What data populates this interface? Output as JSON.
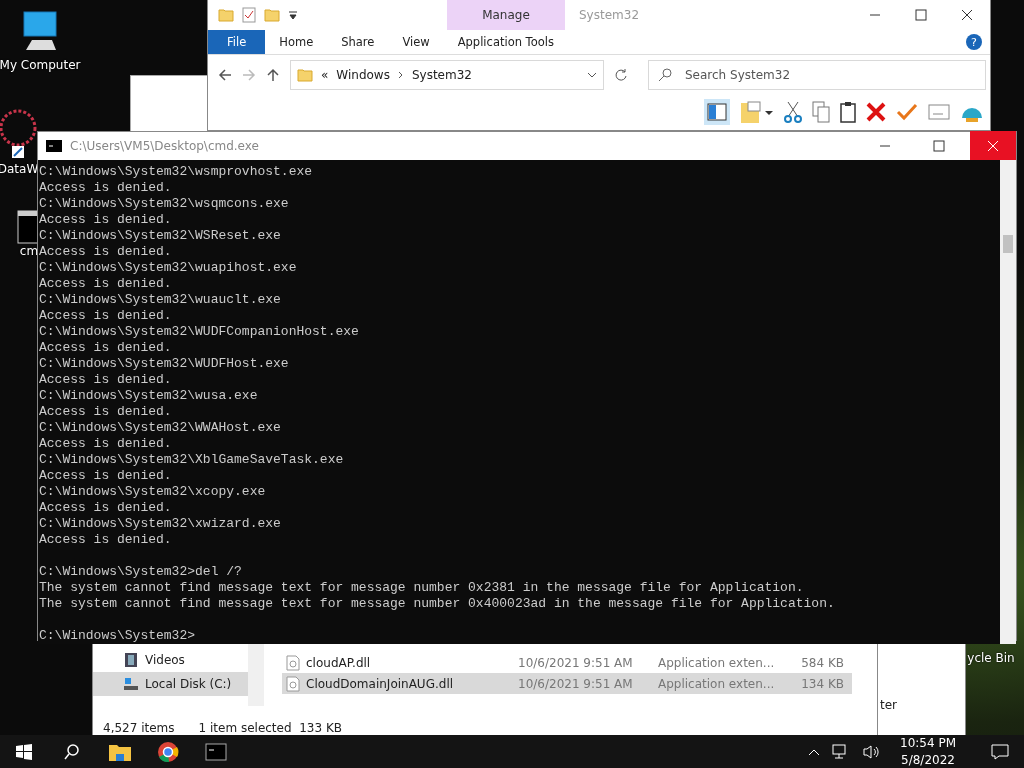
{
  "desktop_icons": [
    {
      "kind": "computer",
      "label": "My Computer"
    },
    {
      "kind": "app",
      "label": "DataW"
    },
    {
      "kind": "console",
      "label": "cm"
    },
    {
      "kind": "bin",
      "label": "ycle Bin"
    }
  ],
  "explorer": {
    "context_tab": "Manage",
    "title": "System32",
    "tabs": [
      {
        "label": "File",
        "selected": true
      },
      {
        "label": "Home",
        "selected": false
      },
      {
        "label": "Share",
        "selected": false
      },
      {
        "label": "View",
        "selected": false
      },
      {
        "label": "Application Tools",
        "selected": false
      }
    ],
    "address_prefix": "«",
    "address": [
      "Windows",
      "System32"
    ],
    "search": {
      "placeholder": "Search System32"
    },
    "help": "?"
  },
  "cmd": {
    "title": "C:\\Users\\VM5\\Desktop\\cmd.exe",
    "blocks": [
      [
        "C:\\Windows\\System32\\wsmprovhost.exe",
        "Access is denied.",
        "C:\\Windows\\System32\\wsqmcons.exe",
        "Access is denied.",
        "C:\\Windows\\System32\\WSReset.exe",
        "Access is denied.",
        "C:\\Windows\\System32\\wuapihost.exe",
        "Access is denied.",
        "C:\\Windows\\System32\\wuauclt.exe",
        "Access is denied.",
        "C:\\Windows\\System32\\WUDFCompanionHost.exe",
        "Access is denied.",
        "C:\\Windows\\System32\\WUDFHost.exe",
        "Access is denied.",
        "C:\\Windows\\System32\\wusa.exe",
        "Access is denied.",
        "C:\\Windows\\System32\\WWAHost.exe",
        "Access is denied.",
        "C:\\Windows\\System32\\XblGameSaveTask.exe",
        "Access is denied.",
        "C:\\Windows\\System32\\xcopy.exe",
        "Access is denied.",
        "C:\\Windows\\System32\\xwizard.exe",
        "Access is denied."
      ],
      [
        "C:\\Windows\\System32>del /?",
        "The system cannot find message text for message number 0x2381 in the message file for Application.",
        "The system cannot find message text for message number 0x400023ad in the message file for Application."
      ],
      [
        "C:\\Windows\\System32>"
      ]
    ]
  },
  "file_window": {
    "nav": [
      {
        "kind": "videos",
        "label": "Videos",
        "selected": false
      },
      {
        "kind": "disk",
        "label": "Local Disk (C:)",
        "selected": true
      }
    ],
    "files": [
      {
        "name": "cloudAP.dll",
        "date": "10/6/2021 9:51 AM",
        "type": "Application exten...",
        "size": "584 KB",
        "selected": false
      },
      {
        "name": "CloudDomainJoinAUG.dll",
        "date": "10/6/2021 9:51 AM",
        "type": "Application exten...",
        "size": "134 KB",
        "selected": true
      }
    ],
    "status": [
      "4,527 items",
      "1 item selected  133 KB"
    ]
  },
  "side_window": {
    "label": "ter"
  },
  "taskbar": {
    "apps": [
      {
        "kind": "explorer"
      },
      {
        "kind": "chrome"
      },
      {
        "kind": "console"
      }
    ],
    "time": "10:54 PM",
    "date": "5/8/2022"
  }
}
